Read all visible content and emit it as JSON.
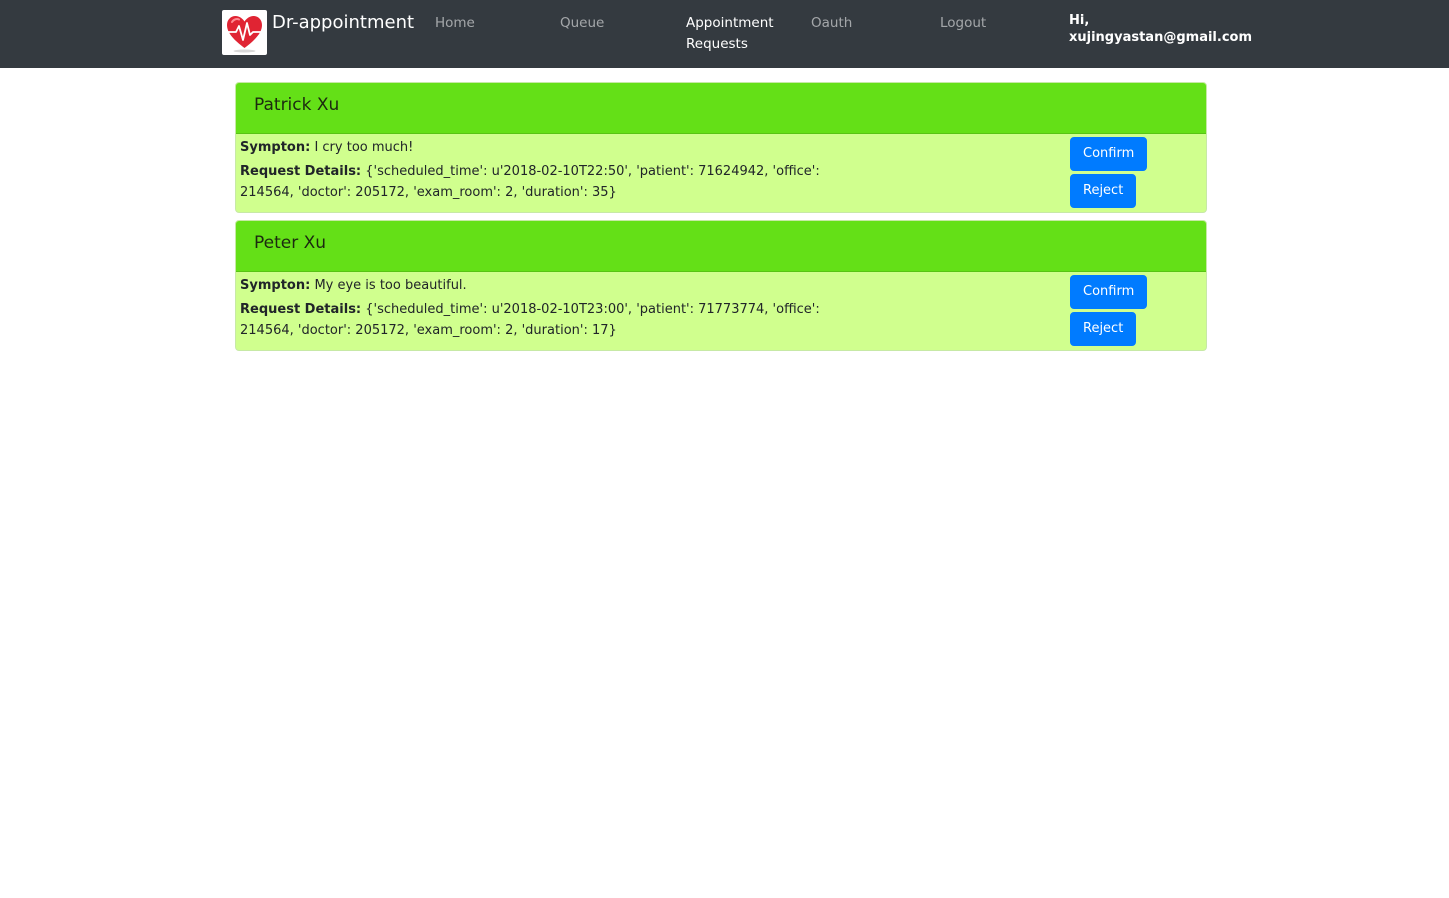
{
  "header": {
    "brand": "Dr-appointment",
    "logo_icon": "heart-pulse-icon",
    "nav": [
      {
        "label": "Home"
      },
      {
        "label": "Queue"
      },
      {
        "label": "Appointment Requests"
      },
      {
        "label": "Oauth"
      },
      {
        "label": "Logout"
      }
    ],
    "greeting_line1": "Hi,",
    "greeting_line2": "xujingyastan@gmail.com"
  },
  "requests": [
    {
      "name": "Patrick Xu",
      "sympton_label": "Sympton:",
      "sympton": "I cry too much!",
      "details_label": "Request Details:",
      "details": "{'scheduled_time': u'2018-02-10T22:50', 'patient': 71624942, 'office': 214564, 'doctor': 205172, 'exam_room': 2, 'duration': 35}",
      "confirm_label": "Confirm",
      "reject_label": "Reject"
    },
    {
      "name": "Peter Xu",
      "sympton_label": "Sympton:",
      "sympton": "My eye is too beautiful.",
      "details_label": "Request Details:",
      "details": "{'scheduled_time': u'2018-02-10T23:00', 'patient': 71773774, 'office': 214564, 'doctor': 205172, 'exam_room': 2, 'duration': 17}",
      "confirm_label": "Confirm",
      "reject_label": "Reject"
    }
  ],
  "colors": {
    "navbar": "#343a40",
    "card_header": "#64e017",
    "card_body": "#d0ff8e",
    "button": "#007bff"
  }
}
